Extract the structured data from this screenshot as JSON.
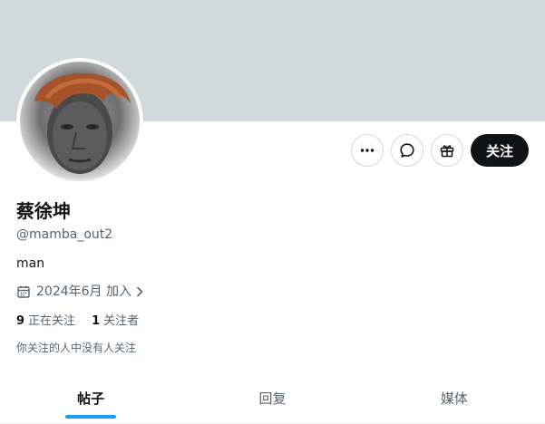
{
  "profile": {
    "name": "蔡徐坤",
    "handle": "@mamba_out2",
    "bio": "man",
    "joined": "2024年6月 加入",
    "following_count": "9",
    "following_label": "正在关注",
    "followers_count": "1",
    "followers_label": "关注者",
    "mutuals_notice": "你关注的人中没有人关注"
  },
  "actions": {
    "follow_label": "关注",
    "more_icon": "more-icon",
    "message_icon": "message-icon",
    "gift_icon": "gift-icon"
  },
  "tabs": [
    {
      "label": "帖子",
      "active": true
    },
    {
      "label": "回复",
      "active": false
    },
    {
      "label": "媒体",
      "active": false
    }
  ],
  "colors": {
    "banner": "#cfd9de",
    "accent": "#1d9bf0",
    "follow_button": "#0f1419",
    "secondary_text": "#536471"
  }
}
